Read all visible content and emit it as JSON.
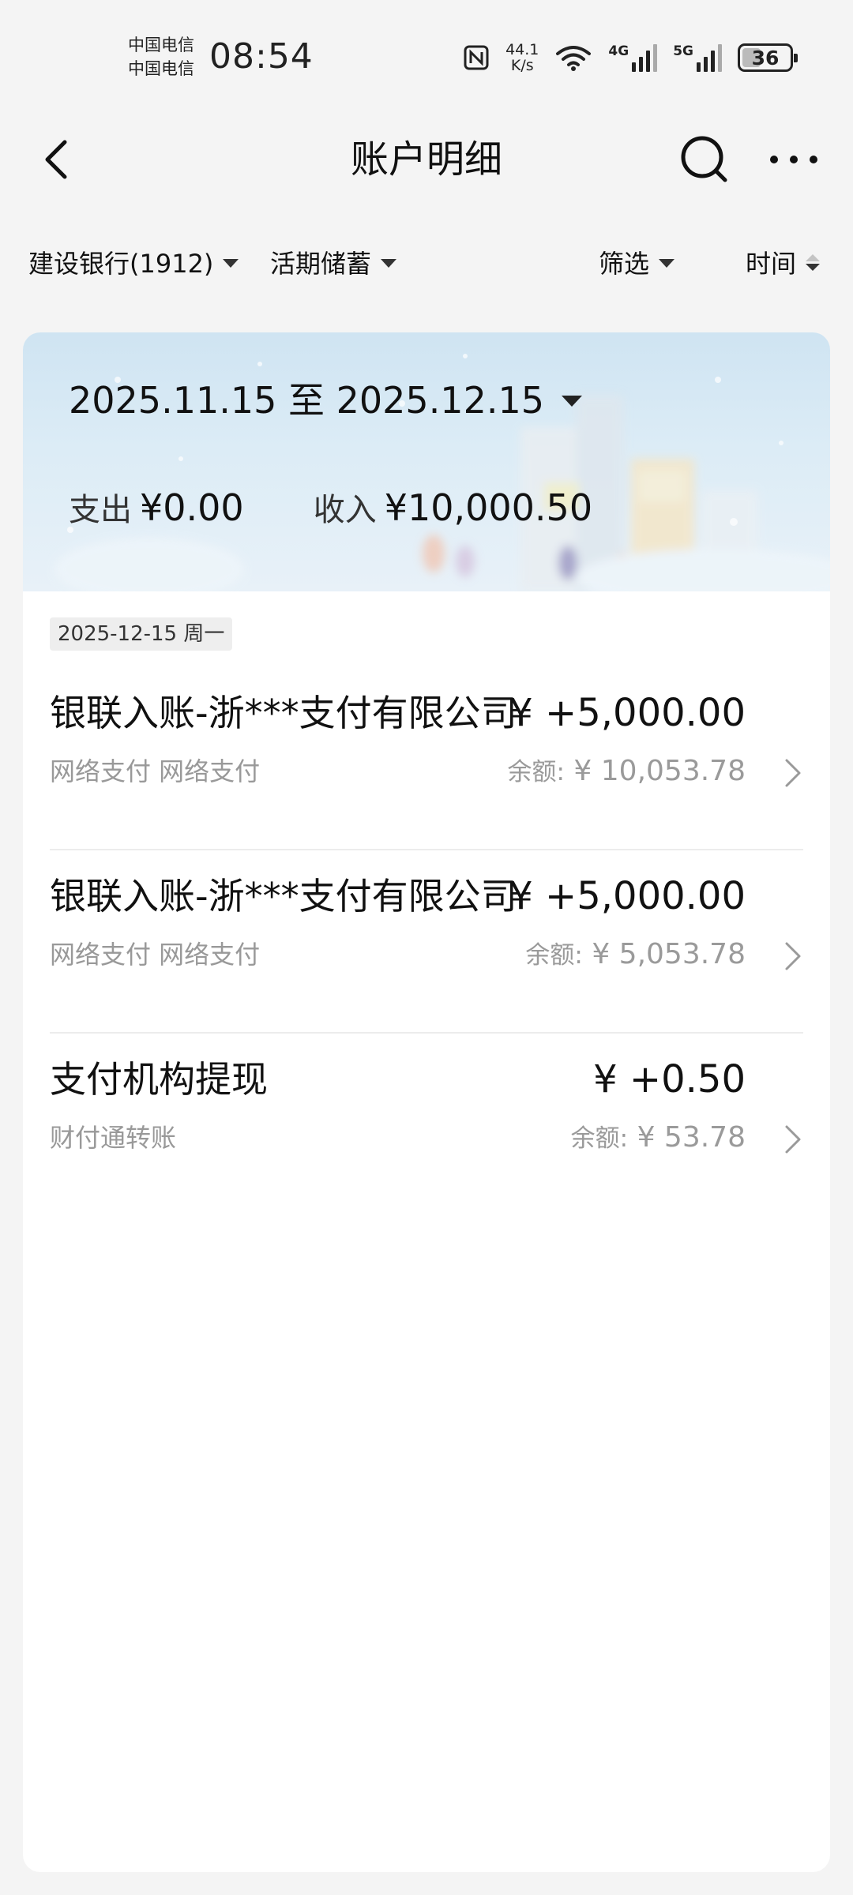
{
  "status_bar": {
    "carrier_1": "中国电信",
    "carrier_2": "中国电信",
    "time": "08:54",
    "net_speed_value": "44.1",
    "net_speed_unit": "K/s",
    "sim1_type": "4G",
    "sim2_type": "5G",
    "battery_level": "36",
    "icons": [
      "nfc-icon",
      "wifi-icon",
      "signal-icon",
      "battery-icon"
    ]
  },
  "header": {
    "title": "账户明细",
    "icons": [
      "back-arrow-icon",
      "search-icon",
      "more-icon"
    ]
  },
  "filters": {
    "account": "建设银行(1912)",
    "account_type": "活期储蓄",
    "filter": "筛选",
    "sort": "时间"
  },
  "summary": {
    "date_range": "2025.11.15 至 2025.12.15",
    "expense_label": "支出",
    "expense_value": "¥0.00",
    "income_label": "收入",
    "income_value": "¥10,000.50"
  },
  "date_group": "2025-12-15 周一",
  "transactions": [
    {
      "title": "银联入账-浙***支付有限公司",
      "amount": "¥ +5,000.00",
      "subtitle": "网络支付 网络支付",
      "balance_label": "余额:",
      "balance_value": "¥ 10,053.78"
    },
    {
      "title": "银联入账-浙***支付有限公司",
      "amount": "¥ +5,000.00",
      "subtitle": "网络支付 网络支付",
      "balance_label": "余额:",
      "balance_value": "¥ 5,053.78"
    },
    {
      "title": "支付机构提现",
      "amount": "¥ +0.50",
      "subtitle": "财付通转账",
      "balance_label": "余额:",
      "balance_value": "¥ 53.78"
    }
  ]
}
